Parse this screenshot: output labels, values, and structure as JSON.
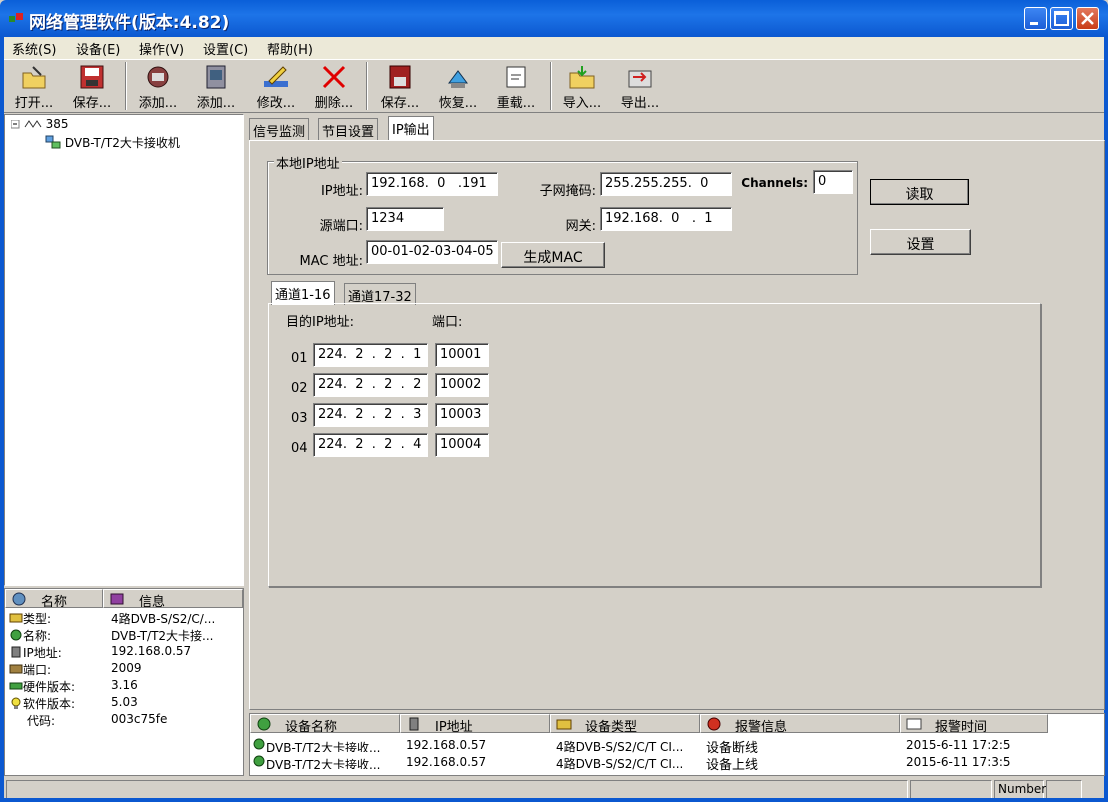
{
  "window": {
    "title": "网络管理软件(版本:4.82)"
  },
  "menu": [
    "系统(S)",
    "设备(E)",
    "操作(V)",
    "设置(C)",
    "帮助(H)"
  ],
  "toolbar": [
    "打开...",
    "保存...",
    "添加...",
    "添加...",
    "修改...",
    "删除...",
    "保存...",
    "恢复...",
    "重载...",
    "导入...",
    "导出..."
  ],
  "tree": {
    "root": "385",
    "child": "DVB-T/T2大卡接收机"
  },
  "props": {
    "header_name": "名称",
    "header_info": "信息",
    "rows": [
      {
        "k": "类型:",
        "v": "4路DVB-S/S2/C/..."
      },
      {
        "k": "名称:",
        "v": "DVB-T/T2大卡接..."
      },
      {
        "k": "IP地址:",
        "v": "192.168.0.57"
      },
      {
        "k": "端口:",
        "v": "2009"
      },
      {
        "k": "硬件版本:",
        "v": "3.16"
      },
      {
        "k": "软件版本:",
        "v": "5.03"
      },
      {
        "k": "代码:",
        "v": "003c75fe"
      }
    ]
  },
  "tabs": [
    "信号监测",
    "节目设置",
    "IP输出"
  ],
  "local": {
    "group_title": "本地IP地址",
    "ip_label": "IP地址:",
    "ip": "192.168.  0   .191",
    "mask_label": "子网掩码:",
    "mask": "255.255.255.  0",
    "channels_label": "Channels:",
    "channels": "0",
    "port_label": "源端口:",
    "port": "1234",
    "gw_label": "网关:",
    "gw": "192.168.  0   .  1",
    "mac_label": "MAC 地址:",
    "mac": "00-01-02-03-04-05",
    "genmac": "生成MAC"
  },
  "buttons": {
    "read": "读取",
    "set": "设置"
  },
  "chtabs": [
    "通道1-16",
    "通道17-32"
  ],
  "channels": {
    "dest_label": "目的IP地址:",
    "port_label": "端口:",
    "rows": [
      {
        "n": "01",
        "ip": "224.  2  .  2  .  1",
        "port": "10001"
      },
      {
        "n": "02",
        "ip": "224.  2  .  2  .  2",
        "port": "10002"
      },
      {
        "n": "03",
        "ip": "224.  2  .  2  .  3",
        "port": "10003"
      },
      {
        "n": "04",
        "ip": "224.  2  .  2  .  4",
        "port": "10004"
      }
    ]
  },
  "alarm": {
    "headers": [
      "设备名称",
      "IP地址",
      "设备类型",
      "报警信息",
      "报警时间"
    ],
    "rows": [
      [
        "DVB-T/T2大卡接收...",
        "192.168.0.57",
        "4路DVB-S/S2/C/T CI...",
        "设备断线",
        "2015-6-11 17:2:5"
      ],
      [
        "DVB-T/T2大卡接收...",
        "192.168.0.57",
        "4路DVB-S/S2/C/T CI...",
        "设备上线",
        "2015-6-11 17:3:5"
      ]
    ]
  },
  "status": {
    "number": "Number"
  }
}
